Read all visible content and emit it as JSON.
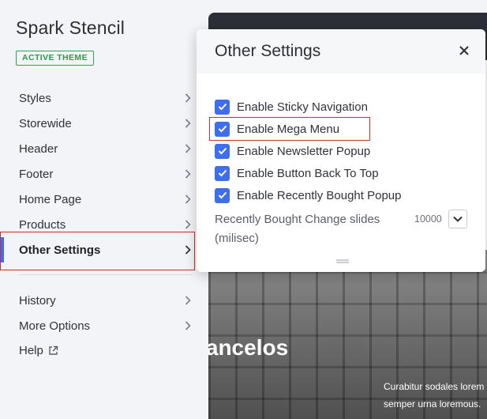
{
  "sidebar": {
    "theme_name": "Spark Stencil",
    "badge": "ACTIVE THEME",
    "items": [
      {
        "label": "Styles"
      },
      {
        "label": "Storewide"
      },
      {
        "label": "Header"
      },
      {
        "label": "Footer"
      },
      {
        "label": "Home Page"
      },
      {
        "label": "Products"
      },
      {
        "label": "Other Settings",
        "active": true
      },
      {
        "label": "History"
      },
      {
        "label": "More Options"
      },
      {
        "label": "Help"
      }
    ],
    "icons": {
      "chevron": "chevron-right-icon",
      "help": "external-link-icon"
    }
  },
  "panel": {
    "title": "Other Settings",
    "close_icon": "close-icon",
    "options": [
      {
        "label": "Enable Sticky Navigation",
        "checked": true
      },
      {
        "label": "Enable Mega Menu",
        "checked": true
      },
      {
        "label": "Enable Newsletter Popup",
        "checked": true
      },
      {
        "label": "Enable Button Back To Top",
        "checked": true
      },
      {
        "label": "Enable Recently Bought Popup",
        "checked": true
      }
    ],
    "slides": {
      "label": "Recently Bought Change slides (milisec)",
      "value": "10000"
    }
  },
  "preview": {
    "hero_title": "Milancelos",
    "hero_sub_line1": "Curabitur sodales lorem",
    "hero_sub_line2": "semper urna loremous."
  },
  "colors": {
    "accent": "#3e6df0",
    "badge_green": "#2ea44f",
    "highlight_red": "#c9302c"
  }
}
